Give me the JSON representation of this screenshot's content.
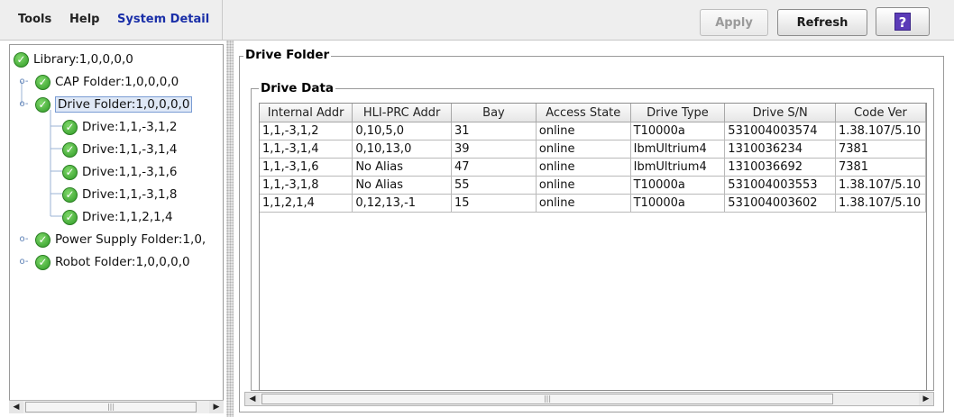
{
  "menu": {
    "tools": "Tools",
    "help": "Help",
    "system_detail": "System Detail"
  },
  "toolbar": {
    "apply_label": "Apply",
    "refresh_label": "Refresh",
    "help_glyph": "?"
  },
  "tree": {
    "library": "Library:1,0,0,0,0",
    "cap_folder": "CAP Folder:1,0,0,0,0",
    "drive_folder": "Drive Folder:1,0,0,0,0",
    "drives": [
      "Drive:1,1,-3,1,2",
      "Drive:1,1,-3,1,4",
      "Drive:1,1,-3,1,6",
      "Drive:1,1,-3,1,8",
      "Drive:1,1,2,1,4"
    ],
    "power_supply_folder": "Power Supply Folder:1,0,",
    "robot_folder": "Robot Folder:1,0,0,0,0"
  },
  "panel": {
    "drive_folder_title": "Drive Folder",
    "drive_data_title": "Drive Data"
  },
  "table": {
    "headers": [
      "Internal Addr",
      "HLI-PRC Addr",
      "Bay",
      "Access State",
      "Drive Type",
      "Drive S/N",
      "Code Ver"
    ],
    "rows": [
      [
        "1,1,-3,1,2",
        "0,10,5,0",
        "31",
        "online",
        "T10000a",
        "531004003574",
        "1.38.107/5.10"
      ],
      [
        "1,1,-3,1,4",
        "0,10,13,0",
        "39",
        "online",
        "IbmUltrium4",
        "1310036234",
        "7381"
      ],
      [
        "1,1,-3,1,6",
        "No Alias",
        "47",
        "online",
        "IbmUltrium4",
        "1310036692",
        "7381"
      ],
      [
        "1,1,-3,1,8",
        "No Alias",
        "55",
        "online",
        "T10000a",
        "531004003553",
        "1.38.107/5.10"
      ],
      [
        "1,1,2,1,4",
        "0,12,13,-1",
        "15",
        "online",
        "T10000a",
        "531004003602",
        "1.38.107/5.10"
      ]
    ]
  },
  "icons": {
    "status_ok": "check-circle-icon",
    "expand": "key-connector-icon",
    "help": "question-icon"
  },
  "colors": {
    "accent_menu": "#1a2fa8",
    "status_ok": "#2f9a26",
    "help_button": "#5b3bb8",
    "selection": "#dfe8f6"
  }
}
